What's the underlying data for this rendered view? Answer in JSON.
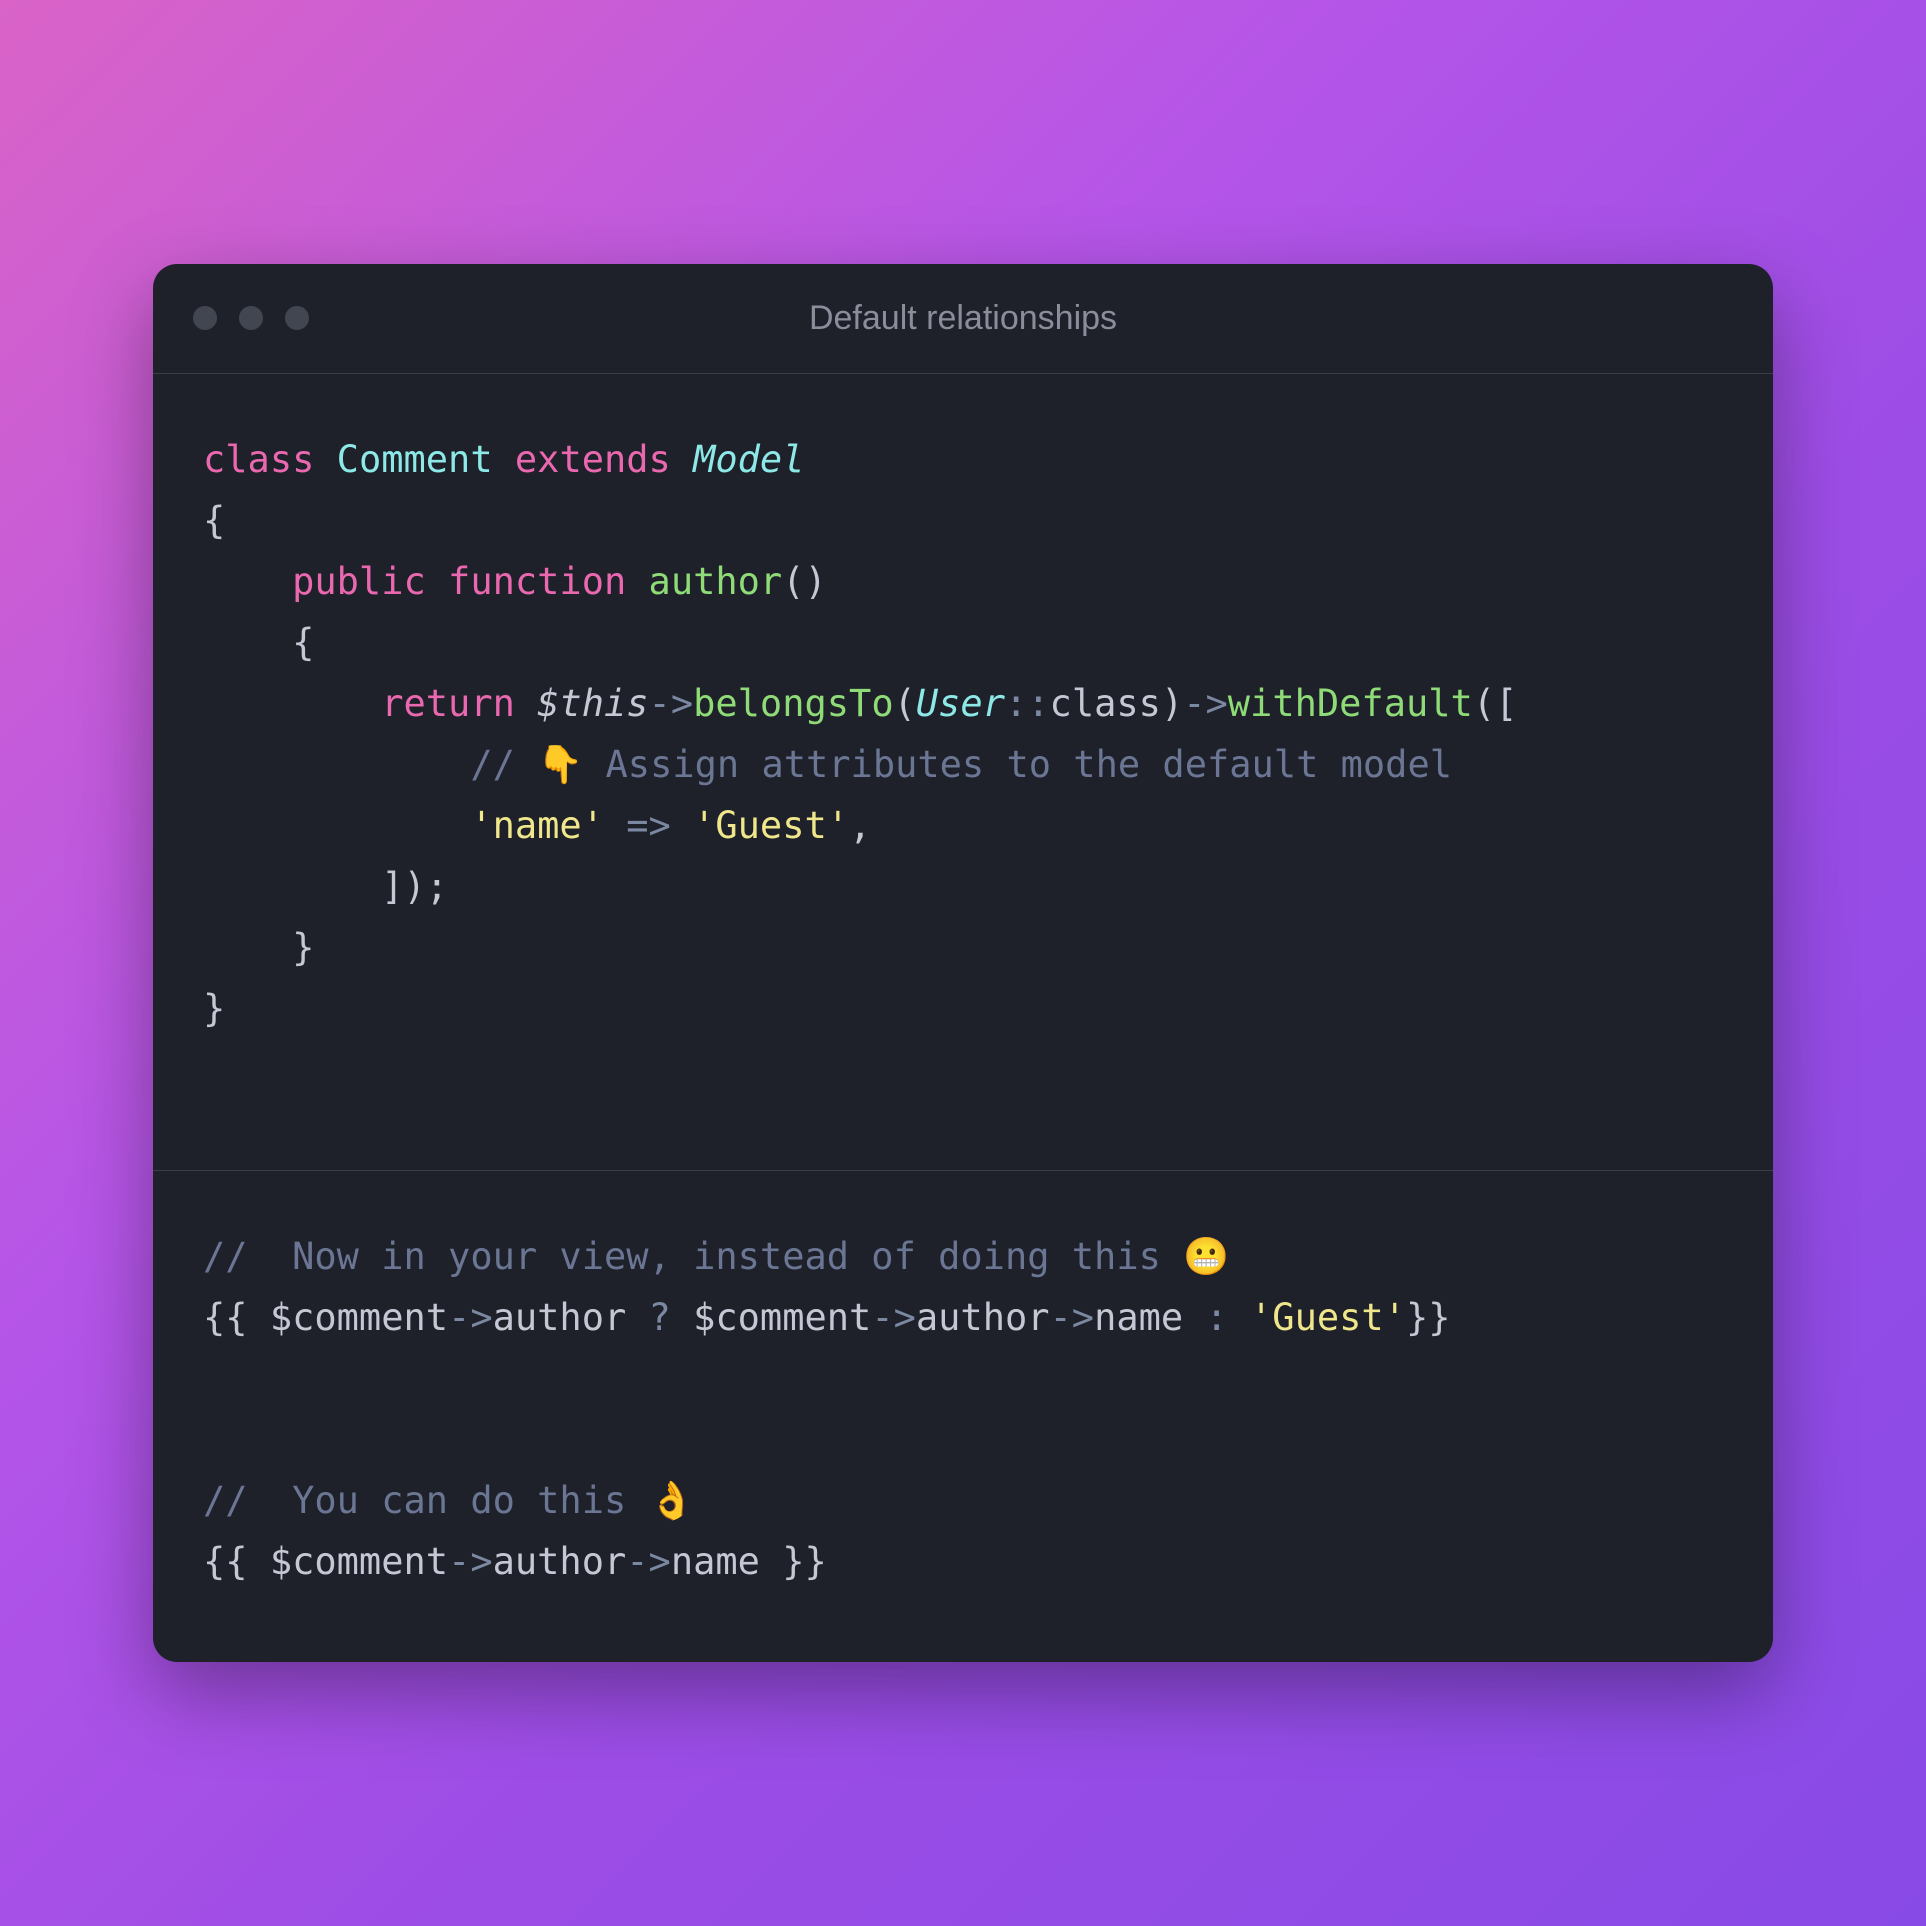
{
  "window": {
    "title": "Default relationships"
  },
  "code": {
    "top": {
      "l1": {
        "class_kw": "class",
        "class_name": "Comment",
        "extends_kw": "extends",
        "model": "Model"
      },
      "l2": {
        "brace": "{"
      },
      "l3": {
        "indent": "    ",
        "public_kw": "public",
        "function_kw": "function",
        "fn_name": "author",
        "parens": "()"
      },
      "l4": {
        "indent": "    ",
        "brace": "{"
      },
      "l5": {
        "indent": "        ",
        "return_kw": "return",
        "this_var": "$this",
        "arrow1": "->",
        "belongs": "belongsTo",
        "lparen": "(",
        "user": "User",
        "scope": "::",
        "class_prop": "class",
        "rparen": ")",
        "arrow2": "->",
        "withdef": "withDefault",
        "open_bracket": "(["
      },
      "l6": {
        "indent": "            ",
        "comment_slashes": "//",
        "emoji": "👇",
        "comment_text": "Assign attributes to the default model"
      },
      "l7": {
        "indent": "            ",
        "key": "'name'",
        "fat_arrow": "=>",
        "value": "'Guest'",
        "comma": ","
      },
      "l8": {
        "indent": "        ",
        "close": "]);"
      },
      "l9": {
        "indent": "    ",
        "brace": "}"
      },
      "l10": {
        "brace": "}"
      }
    },
    "bottom": {
      "l1": {
        "slashes": "//",
        "text": "Now in your view, instead of doing this",
        "emoji": "😬"
      },
      "l2": {
        "open": "{{ ",
        "var1": "$comment",
        "arr1": "->",
        "prop1": "author",
        "q": " ? ",
        "var2": "$comment",
        "arr2": "->",
        "prop2": "author",
        "arr3": "->",
        "prop3": "name",
        "colon": " : ",
        "str": "'Guest'",
        "close": "}}"
      },
      "l3": {
        "slashes": "//",
        "text": "You can do this",
        "emoji": "👌"
      },
      "l4": {
        "open": "{{ ",
        "var": "$comment",
        "arr1": "->",
        "prop1": "author",
        "arr2": "->",
        "prop2": "name",
        "close": " }}"
      }
    }
  }
}
